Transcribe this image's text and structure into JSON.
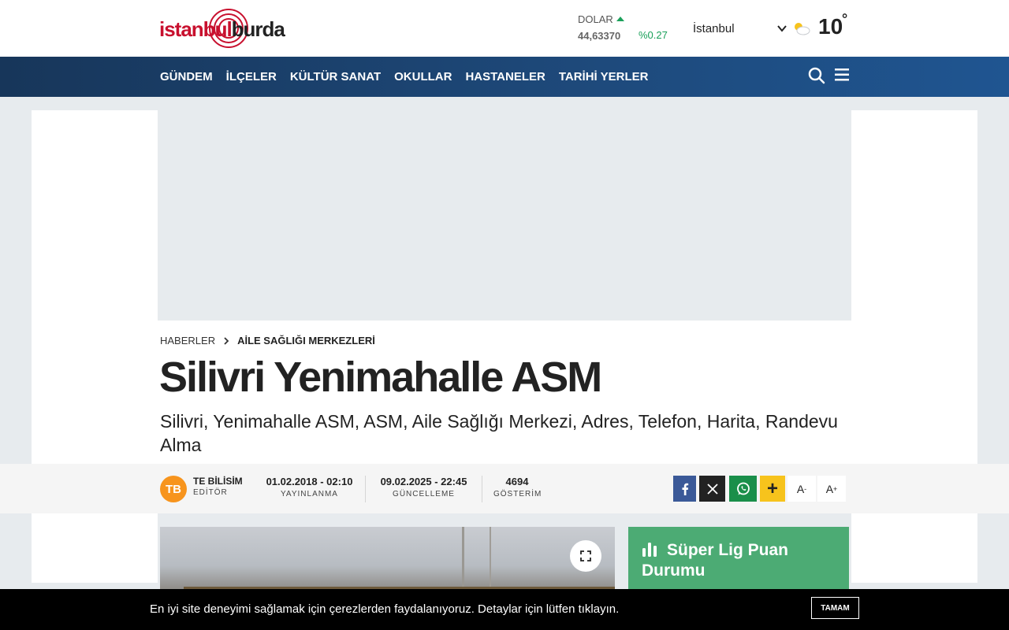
{
  "header": {
    "logo": {
      "part1": "istanbul",
      "part2": "burda"
    },
    "currency": {
      "label": "DOLAR",
      "value": "44,63370",
      "change": "%0.27",
      "trend_icon": "arrow-up-icon"
    },
    "city": "İstanbul",
    "weather": {
      "icon": "partly-cloudy-icon",
      "temperature": "10",
      "degree_symbol": "°"
    }
  },
  "nav": {
    "items": [
      {
        "label": "GÜNDEM"
      },
      {
        "label": "İLÇELER"
      },
      {
        "label": "KÜLTÜR SANAT"
      },
      {
        "label": "OKULLAR"
      },
      {
        "label": "HASTANELER"
      },
      {
        "label": "TARİHİ YERLER"
      }
    ],
    "search_icon": "search-icon",
    "menu_icon": "hamburger-menu-icon"
  },
  "breadcrumb": {
    "home": "HABERLER",
    "category": "AİLE SAĞLIĞI MERKEZLERİ"
  },
  "article": {
    "title": "Silivri Yenimahalle ASM",
    "subtitle": "Silivri, Yenimahalle ASM, ASM, Aile Sağlığı Merkezi, Adres, Telefon, Harita, Randevu Alma"
  },
  "meta": {
    "author": {
      "initials": "TB",
      "name": "TE BİLİSİM",
      "role": "EDİTÖR"
    },
    "published": {
      "value": "01.02.2018 - 02:10",
      "label": "YAYINLANMA"
    },
    "updated": {
      "value": "09.02.2025 - 22:45",
      "label": "GÜNCELLEME"
    },
    "views": {
      "value": "4694",
      "label": "GÖSTERİM"
    }
  },
  "share": {
    "plus_label": "+",
    "font_decrease": {
      "base": "A",
      "sup": "-"
    },
    "font_increase": {
      "base": "A",
      "sup": "+"
    }
  },
  "sidebar": {
    "league_title": "Süper Lig Puan Durumu"
  },
  "cookie": {
    "text": "En iyi site deneyimi sağlamak için çerezlerden faydalanıyoruz. Detaylar için lütfen tıklayın.",
    "button": "TAMAM"
  },
  "colors": {
    "nav_bg": "#1e4a7c",
    "brand_red": "#c8102e",
    "positive": "#1aa05a",
    "avatar": "#f7941d",
    "facebook": "#3b5998",
    "whatsapp": "#1a8f4a",
    "plus": "#f7c31c",
    "league": "#4cab74"
  }
}
